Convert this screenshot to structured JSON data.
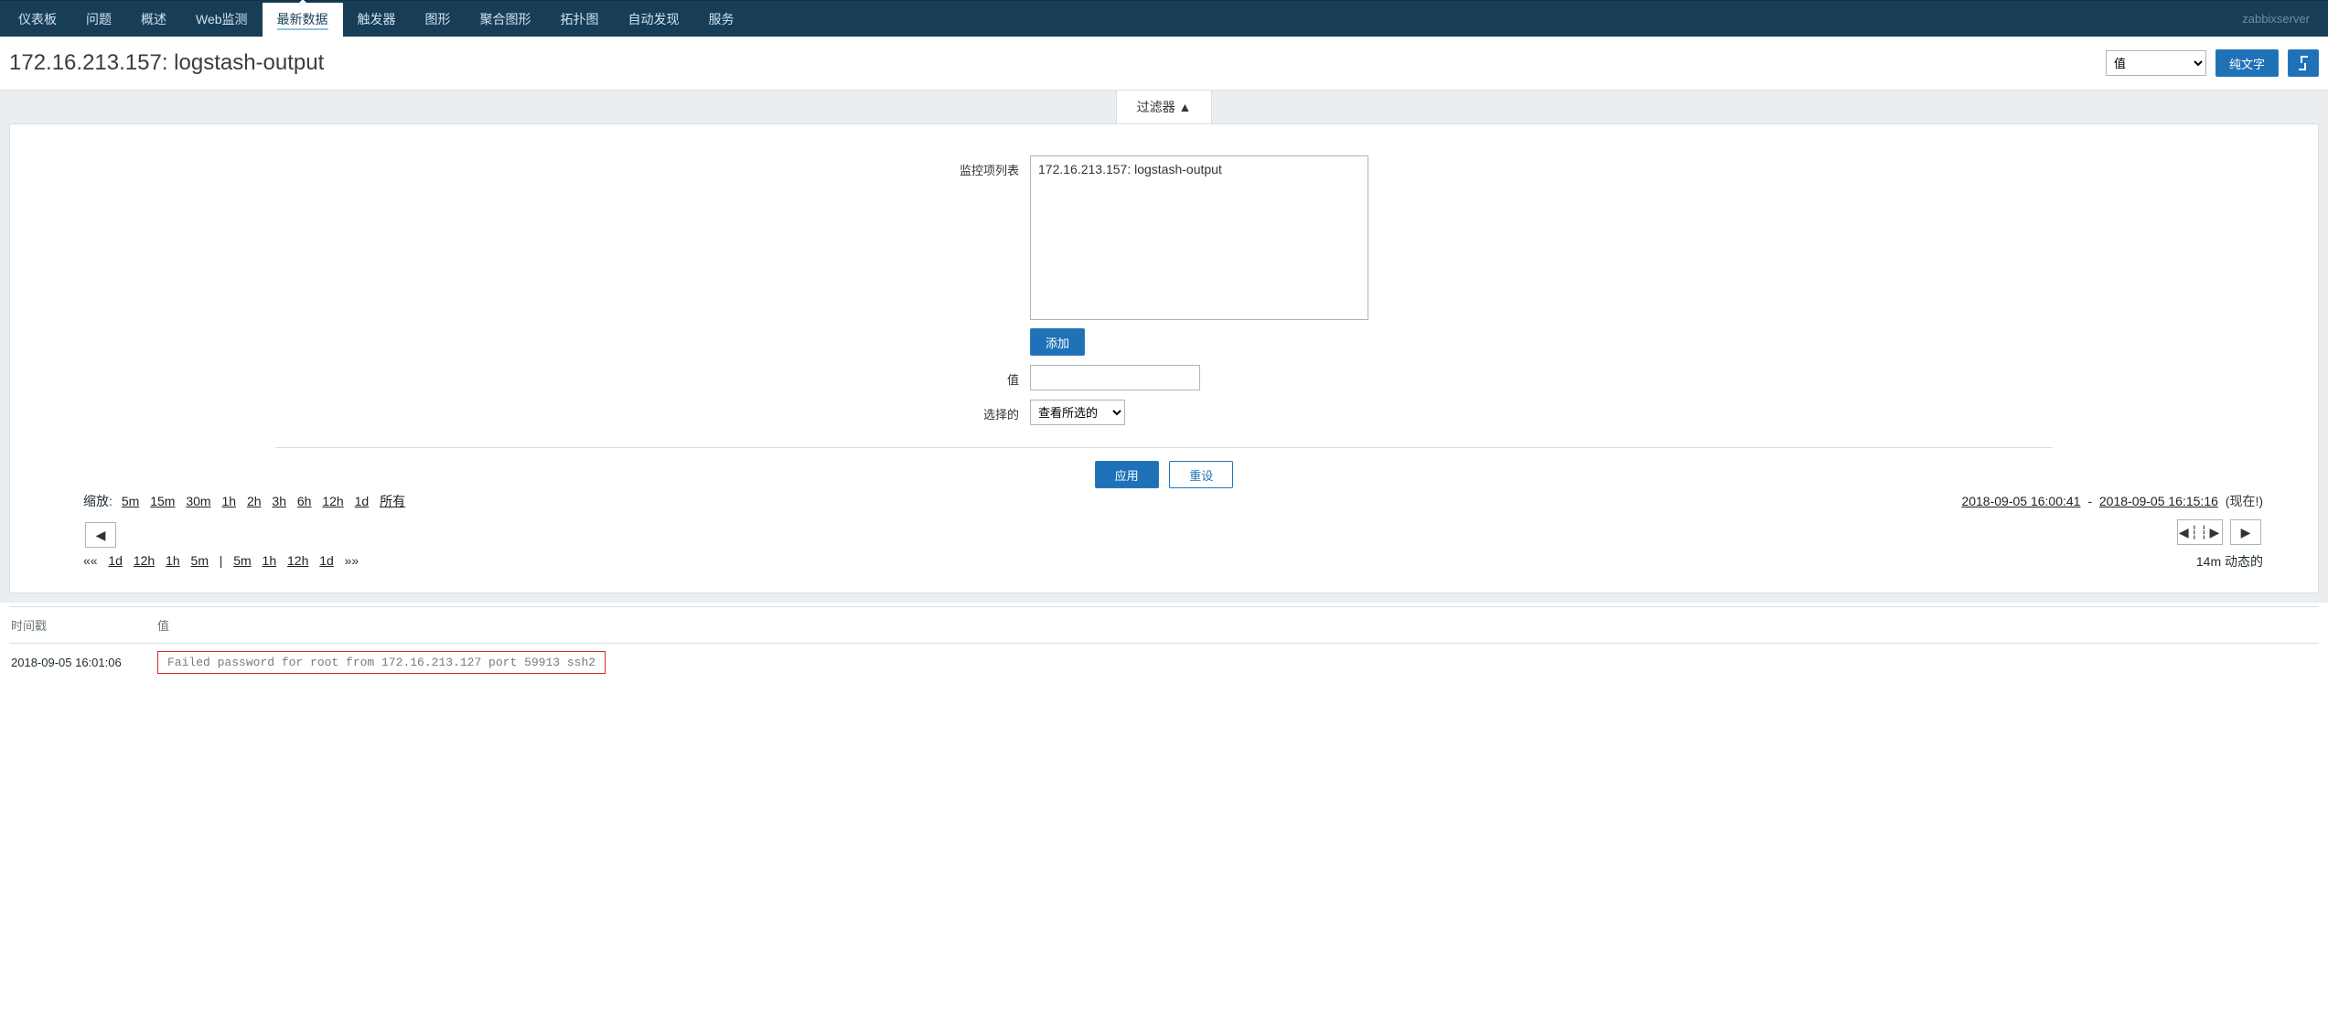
{
  "nav": {
    "items": [
      {
        "label": "仪表板"
      },
      {
        "label": "问题"
      },
      {
        "label": "概述"
      },
      {
        "label": "Web监测"
      },
      {
        "label": "最新数据",
        "active": true
      },
      {
        "label": "触发器"
      },
      {
        "label": "图形"
      },
      {
        "label": "聚合图形"
      },
      {
        "label": "拓扑图"
      },
      {
        "label": "自动发现"
      },
      {
        "label": "服务"
      }
    ],
    "server": "zabbixserver"
  },
  "title": "172.16.213.157: logstash-output",
  "titlebar": {
    "mode_select": "值",
    "plain_text_btn": "纯文字"
  },
  "filter": {
    "tab_label": "过滤器 ▲",
    "itemlist_label": "监控项列表",
    "itemlist_value": "172.16.213.157: logstash-output",
    "add_btn": "添加",
    "value_label": "值",
    "value_input": "",
    "selected_label": "选择的",
    "selected_option": "查看所选的",
    "apply_btn": "应用",
    "reset_btn": "重设"
  },
  "zoom": {
    "label": "缩放:",
    "options": [
      "5m",
      "15m",
      "30m",
      "1h",
      "2h",
      "3h",
      "6h",
      "12h",
      "1d",
      "所有"
    ],
    "range_from": "2018-09-05 16:00:41",
    "range_sep": " - ",
    "range_to": "2018-09-05 16:15:16",
    "now_note": "(现在!)",
    "rewind_left": [
      "1d",
      "12h",
      "1h",
      "5m"
    ],
    "rewind_right": [
      "5m",
      "1h",
      "12h",
      "1d"
    ],
    "dyn_label": "14m  动态的"
  },
  "table": {
    "headers": {
      "ts": "时间戳",
      "val": "值"
    },
    "rows": [
      {
        "ts": "2018-09-05 16:01:06",
        "val": "Failed password for root from 172.16.213.127 port 59913 ssh2"
      }
    ]
  }
}
